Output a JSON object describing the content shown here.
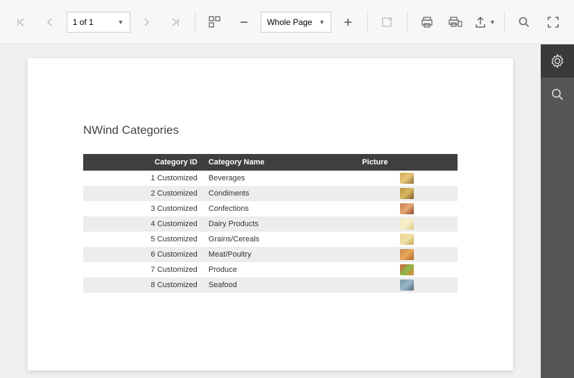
{
  "toolbar": {
    "page_label": "1 of 1",
    "zoom_label": "Whole Page"
  },
  "report": {
    "title": "NWind Categories",
    "columns": [
      "Category ID",
      "Category Name",
      "Picture"
    ],
    "rows": [
      {
        "id": "1 Customized",
        "name": "Beverages",
        "pic": "linear-gradient(135deg,#d4a85a,#e8c878,#8b6f3e)"
      },
      {
        "id": "2 Customized",
        "name": "Condiments",
        "pic": "linear-gradient(135deg,#b8923f,#d8b860,#7a5a2a)"
      },
      {
        "id": "3 Customized",
        "name": "Confections",
        "pic": "linear-gradient(135deg,#c77a4a,#e8a878,#8b4a2e)"
      },
      {
        "id": "4 Customized",
        "name": "Dairy Products",
        "pic": "linear-gradient(135deg,#f0e8b8,#f8f0d0,#d8c878)"
      },
      {
        "id": "5 Customized",
        "name": "Grains/Cereals",
        "pic": "linear-gradient(135deg,#e8d088,#f0e0a8,#c8a858)"
      },
      {
        "id": "6 Customized",
        "name": "Meat/Poultry",
        "pic": "linear-gradient(135deg,#c88848,#e8a858,#a86828)"
      },
      {
        "id": "7 Customized",
        "name": "Produce",
        "pic": "linear-gradient(135deg,#d85838,#88b848,#e88838)"
      },
      {
        "id": "8 Customized",
        "name": "Seafood",
        "pic": "linear-gradient(135deg,#7898a8,#98b8c8,#586878)"
      }
    ]
  }
}
